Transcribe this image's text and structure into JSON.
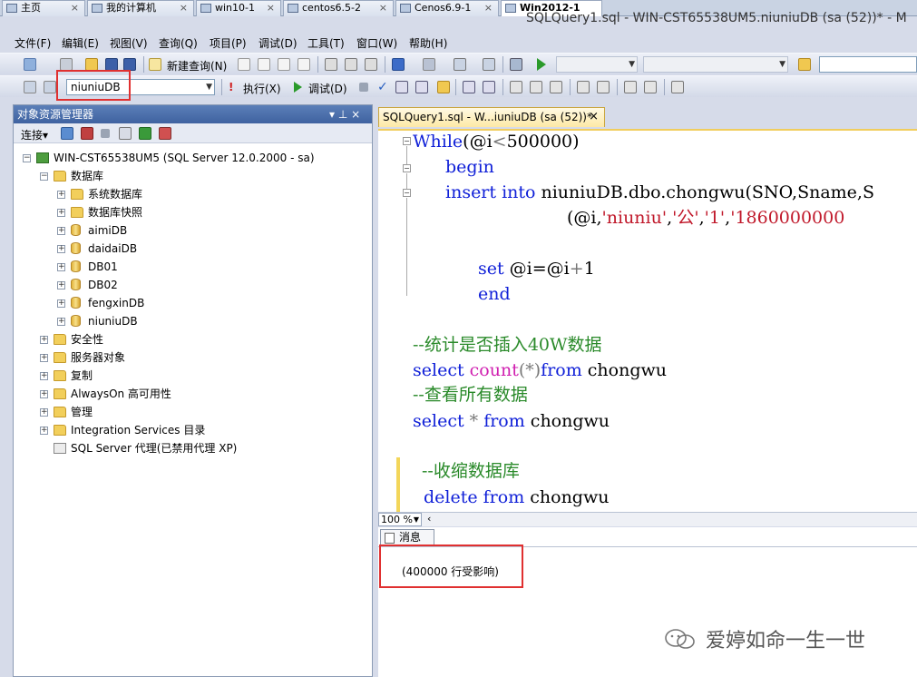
{
  "vm_tabs": [
    {
      "label": "主页",
      "active": false
    },
    {
      "label": "我的计算机",
      "active": false
    },
    {
      "label": "win10-1",
      "active": false
    },
    {
      "label": "centos6.5-2",
      "active": false
    },
    {
      "label": "Cenos6.9-1",
      "active": false
    },
    {
      "label": "Win2012-1",
      "active": true
    }
  ],
  "tab_close": "×",
  "window_title": "SQLQuery1.sql - WIN-CST65538UM5.niuniuDB (sa (52))* - M",
  "menu": [
    "文件(F)",
    "编辑(E)",
    "视图(V)",
    "查询(Q)",
    "项目(P)",
    "调试(D)",
    "工具(T)",
    "窗口(W)",
    "帮助(H)"
  ],
  "toolbar1": {
    "new_query": "新建查询(N)"
  },
  "toolbar2": {
    "database_selected": "niuniuDB",
    "execute": "执行(X)",
    "debug": "调试(D)"
  },
  "object_explorer": {
    "title": "对象资源管理器",
    "pin": "▾ ⊥ ×",
    "connect": "连接▾",
    "tree": [
      {
        "label": "WIN-CST65538UM5 (SQL Server 12.0.2000 - sa)",
        "level": 0,
        "icon": "server-icon",
        "expander": "−"
      },
      {
        "label": "数据库",
        "level": 1,
        "icon": "folder-icon",
        "expander": "−"
      },
      {
        "label": "系统数据库",
        "level": 2,
        "icon": "folder-icon",
        "expander": "+"
      },
      {
        "label": "数据库快照",
        "level": 2,
        "icon": "folder-icon",
        "expander": "+"
      },
      {
        "label": "aimiDB",
        "level": 2,
        "icon": "database-icon",
        "expander": "+"
      },
      {
        "label": "daidaiDB",
        "level": 2,
        "icon": "database-icon",
        "expander": "+"
      },
      {
        "label": "DB01",
        "level": 2,
        "icon": "database-icon",
        "expander": "+"
      },
      {
        "label": "DB02",
        "level": 2,
        "icon": "database-icon",
        "expander": "+"
      },
      {
        "label": "fengxinDB",
        "level": 2,
        "icon": "database-icon",
        "expander": "+"
      },
      {
        "label": "niuniuDB",
        "level": 2,
        "icon": "database-icon",
        "expander": "+"
      },
      {
        "label": "安全性",
        "level": 1,
        "icon": "folder-icon",
        "expander": "+"
      },
      {
        "label": "服务器对象",
        "level": 1,
        "icon": "folder-icon",
        "expander": "+"
      },
      {
        "label": "复制",
        "level": 1,
        "icon": "folder-icon",
        "expander": "+"
      },
      {
        "label": "AlwaysOn 高可用性",
        "level": 1,
        "icon": "folder-icon",
        "expander": "+"
      },
      {
        "label": "管理",
        "level": 1,
        "icon": "folder-icon",
        "expander": "+"
      },
      {
        "label": "Integration Services 目录",
        "level": 1,
        "icon": "folder-icon",
        "expander": "+"
      },
      {
        "label": "SQL Server 代理(已禁用代理 XP)",
        "level": 1,
        "icon": "agent-icon",
        "expander": ""
      }
    ]
  },
  "editor": {
    "tab_label": "SQLQuery1.sql - W...iuniuDB (sa (52))*",
    "tab_close": "×",
    "code": {
      "l1_kw": "While",
      "l1_rest": "(@i",
      "l1_op": "<",
      "l1_end": "500000)",
      "l2": "begin",
      "l3_kw": "insert into",
      "l3_rest": " niuniuDB.dbo.chongwu(SNO,Sname,S",
      "l4_a": "(@i,",
      "l4_s1": "'niuniu'",
      "l4_c1": ",",
      "l4_s2": "'公'",
      "l4_c2": ",",
      "l4_s3": "'1'",
      "l4_c3": ",",
      "l4_s4": "'1860000000",
      "l5_kw": "set",
      "l5_rest": " @i=@i",
      "l5_op": "+",
      "l5_end": "1",
      "l6": "end",
      "c1": "--统计是否插入40W数据",
      "l7_kw": "select",
      "l7_fn": "count",
      "l7_op": "(*)",
      "l7_kw2": "from",
      "l7_rest": " chongwu",
      "c2": "--查看所有数据",
      "l8_kw": "select",
      "l8_op": " * ",
      "l8_kw2": "from",
      "l8_rest": " chongwu",
      "c3": "--收缩数据库",
      "l9_kw": "delete from",
      "l9_rest": " chongwu"
    },
    "zoom": "100 %",
    "results": {
      "tab": "消息",
      "message": "(400000 行受影响)"
    }
  },
  "watermark": "爱婷如命一生一世",
  "colors": {
    "keyword": "#1020d8",
    "string": "#c0182a",
    "comment": "#2a8a2a",
    "function": "#d020b0",
    "highlight": "#e03030"
  }
}
